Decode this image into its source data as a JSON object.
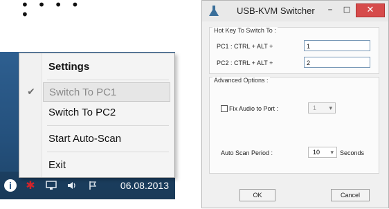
{
  "tray_menu": {
    "items": [
      {
        "label": "Settings"
      },
      {
        "label": "Switch To PC1"
      },
      {
        "label": "Switch To PC2"
      },
      {
        "label": "Start Auto-Scan"
      },
      {
        "label": "Exit"
      }
    ],
    "checked_item": "Switch To PC1",
    "check_glyph": "✔"
  },
  "taskbar": {
    "date": "06.08.2013",
    "icons": [
      "info-icon",
      "kvm-tray-icon",
      "network-icon",
      "volume-icon",
      "flag-icon"
    ]
  },
  "dialog": {
    "title": "USB-KVM Switcher",
    "controls": {
      "minimize": "–",
      "maximize": "□",
      "close": "✕"
    },
    "hotkey_group": {
      "legend": "Hot Key To Switch To :",
      "pc1_label": "PC1 : CTRL + ALT +",
      "pc1_value": "1",
      "pc2_label": "PC2 : CTRL + ALT +",
      "pc2_value": "2"
    },
    "advanced_group": {
      "legend": "Advanced Options :",
      "fix_audio_label": "Fix Audio to Port :",
      "fix_audio_checked": false,
      "fix_audio_port": "1",
      "auto_scan_label": "Auto Scan Period :",
      "auto_scan_value": "10",
      "auto_scan_unit": "Seconds"
    },
    "ok_label": "OK",
    "cancel_label": "Cancel"
  }
}
